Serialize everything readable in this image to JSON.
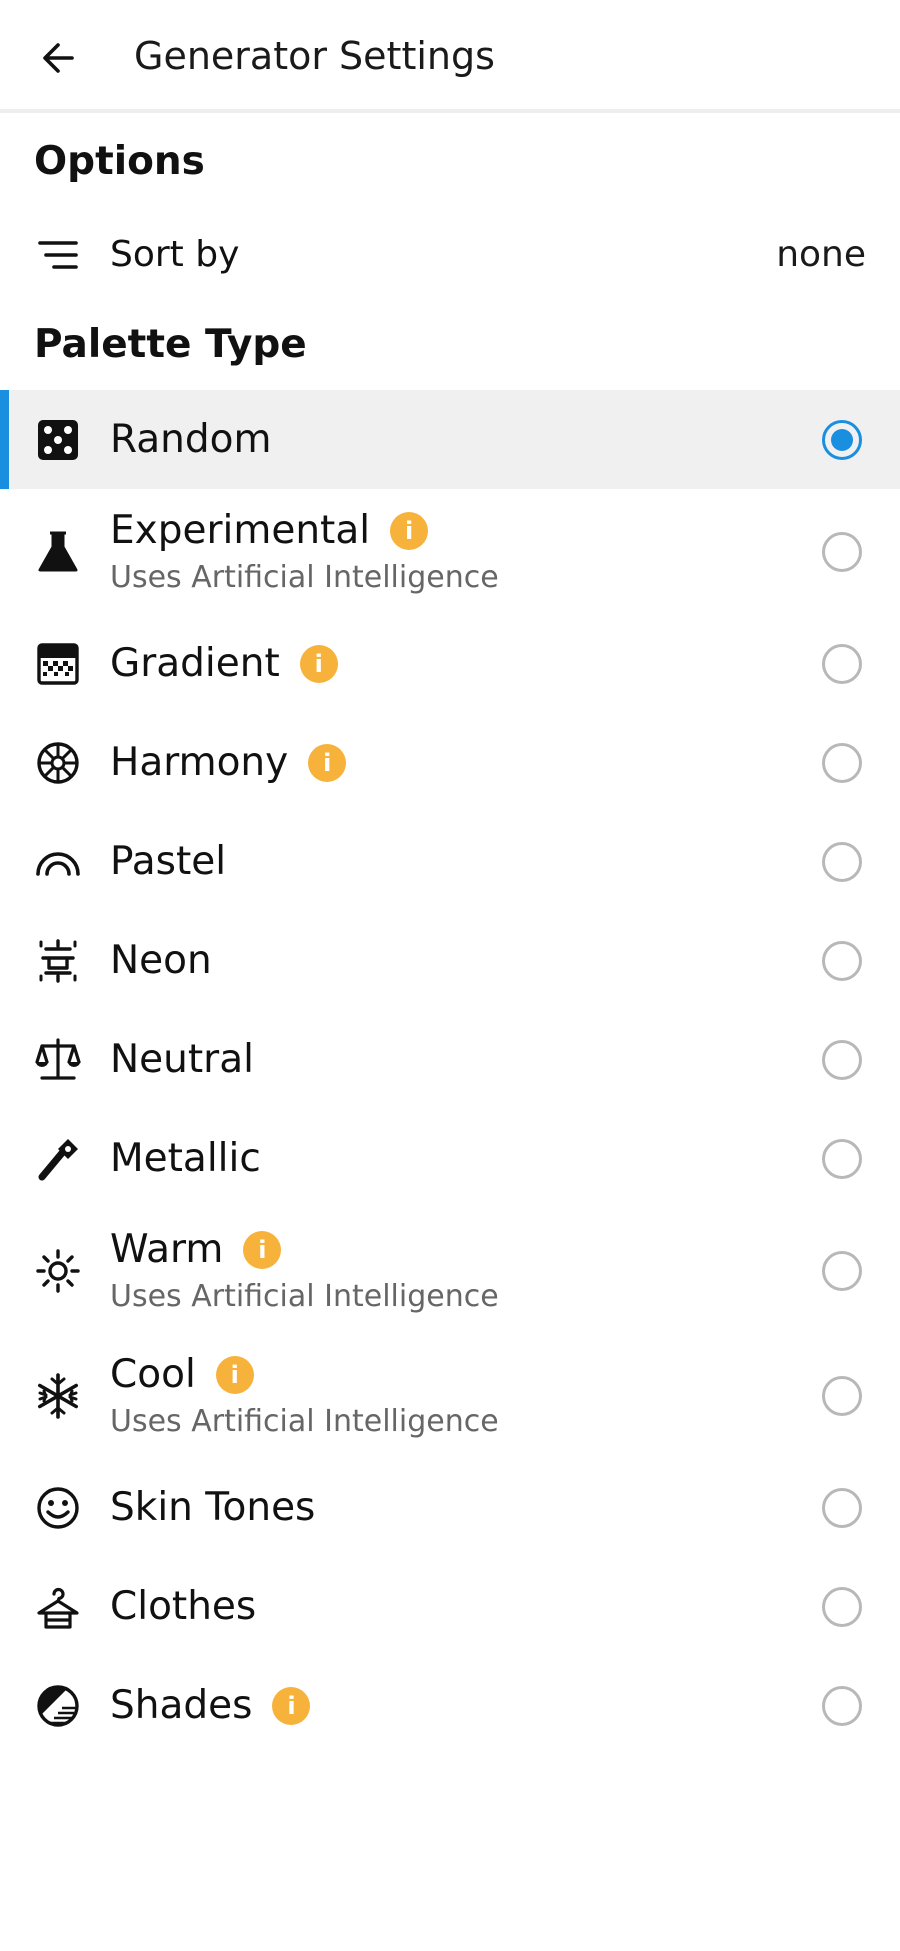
{
  "appbar": {
    "title": "Generator Settings",
    "back_icon": "arrow-left-icon"
  },
  "options": {
    "title": "Options",
    "sort": {
      "label": "Sort by",
      "value": "none",
      "icon": "sort-lines-icon"
    }
  },
  "palette": {
    "title": "Palette Type",
    "accent_color": "#1a8fe0",
    "info_color": "#f7b23b",
    "info_glyph": "i",
    "items": [
      {
        "label": "Random",
        "subtitle": "",
        "icon": "dice-icon",
        "info": false,
        "selected": true
      },
      {
        "label": "Experimental",
        "subtitle": "Uses Artificial Intelligence",
        "icon": "flask-icon",
        "info": true,
        "selected": false
      },
      {
        "label": "Gradient",
        "subtitle": "",
        "icon": "gradient-icon",
        "info": true,
        "selected": false
      },
      {
        "label": "Harmony",
        "subtitle": "",
        "icon": "color-wheel-icon",
        "info": true,
        "selected": false
      },
      {
        "label": "Pastel",
        "subtitle": "",
        "icon": "rainbow-icon",
        "info": false,
        "selected": false
      },
      {
        "label": "Neon",
        "subtitle": "",
        "icon": "neon-sign-icon",
        "info": false,
        "selected": false
      },
      {
        "label": "Neutral",
        "subtitle": "",
        "icon": "scale-icon",
        "info": false,
        "selected": false
      },
      {
        "label": "Metallic",
        "subtitle": "",
        "icon": "wrench-icon",
        "info": false,
        "selected": false
      },
      {
        "label": "Warm",
        "subtitle": "Uses Artificial Intelligence",
        "icon": "sun-icon",
        "info": true,
        "selected": false
      },
      {
        "label": "Cool",
        "subtitle": "Uses Artificial Intelligence",
        "icon": "snowflake-icon",
        "info": true,
        "selected": false
      },
      {
        "label": "Skin Tones",
        "subtitle": "",
        "icon": "smiley-icon",
        "info": false,
        "selected": false
      },
      {
        "label": "Clothes",
        "subtitle": "",
        "icon": "hanger-icon",
        "info": false,
        "selected": false
      },
      {
        "label": "Shades",
        "subtitle": "",
        "icon": "shades-circle-icon",
        "info": true,
        "selected": false
      }
    ]
  }
}
